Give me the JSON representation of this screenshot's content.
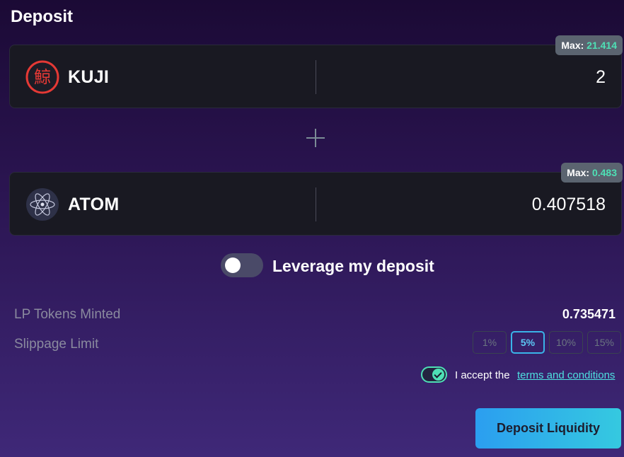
{
  "header": {
    "title": "Deposit"
  },
  "tokens": [
    {
      "symbol": "KUJI",
      "amount": "2",
      "max_label": "Max:",
      "max_value": "21.414",
      "icon": "kuji-logo-icon"
    },
    {
      "symbol": "ATOM",
      "amount": "0.407518",
      "max_label": "Max:",
      "max_value": "0.483",
      "icon": "atom-logo-icon"
    }
  ],
  "leverage": {
    "label": "Leverage my deposit",
    "enabled": false
  },
  "summary": {
    "lp_label": "LP Tokens Minted",
    "lp_value": "0.735471",
    "slippage_label": "Slippage Limit",
    "slippage_options": [
      "1%",
      "5%",
      "10%",
      "15%"
    ],
    "slippage_selected": "5%"
  },
  "terms": {
    "prefix": "I accept the",
    "link": "terms and conditions",
    "accepted": true
  },
  "actions": {
    "deposit_label": "Deposit Liquidity"
  },
  "colors": {
    "accent": "#4ee0b5",
    "button_gradient_start": "#2b9ef0",
    "button_gradient_end": "#35c9e0"
  }
}
